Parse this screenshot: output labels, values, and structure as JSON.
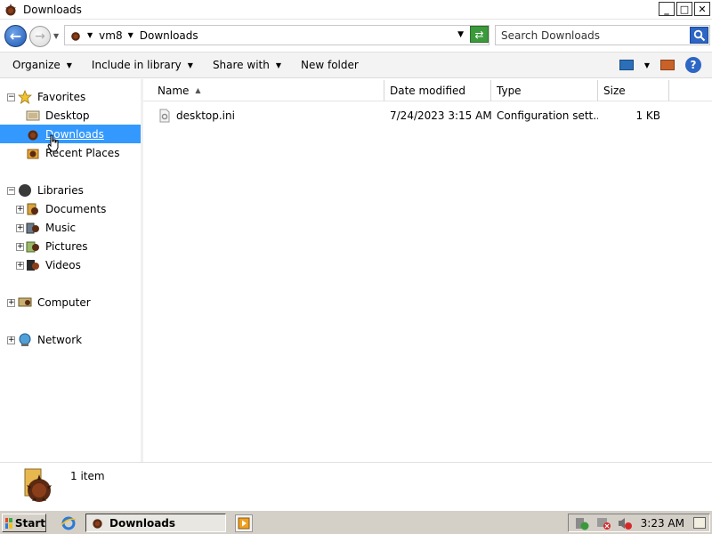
{
  "window": {
    "title": "Downloads"
  },
  "window_controls": {
    "minimize": "_",
    "maximize": "□",
    "close": "✕"
  },
  "address": {
    "crumbs": [
      "vm8",
      "Downloads"
    ],
    "search_placeholder": "Search Downloads"
  },
  "toolbar": {
    "organize": "Organize",
    "include_in_library": "Include in library",
    "share_with": "Share with",
    "new_folder": "New folder"
  },
  "nav": {
    "favorites": "Favorites",
    "desktop": "Desktop",
    "downloads": "Downloads",
    "recent_places": "Recent Places",
    "libraries": "Libraries",
    "documents": "Documents",
    "music": "Music",
    "pictures": "Pictures",
    "videos": "Videos",
    "computer": "Computer",
    "network": "Network"
  },
  "columns": {
    "name": "Name",
    "date_modified": "Date modified",
    "type": "Type",
    "size": "Size"
  },
  "files": [
    {
      "name": "desktop.ini",
      "date": "7/24/2023 3:15 AM",
      "type": "Configuration sett...",
      "size": "1 KB"
    }
  ],
  "details": {
    "count": "1 item"
  },
  "taskbar": {
    "start": "Start",
    "task_downloads": "Downloads",
    "clock": "3:23 AM"
  }
}
